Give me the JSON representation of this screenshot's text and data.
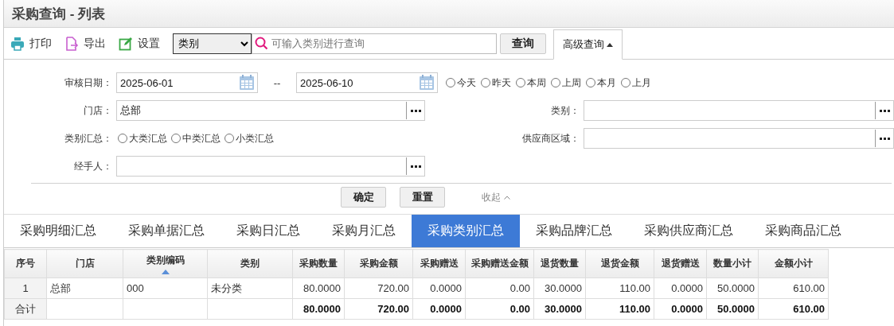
{
  "window": {
    "title": "采购查询 - 列表"
  },
  "toolbar": {
    "buttons": [
      {
        "kind": "print",
        "label": "打印"
      },
      {
        "kind": "export",
        "label": "导出"
      },
      {
        "kind": "settings",
        "label": "设置"
      }
    ],
    "field_select": {
      "value": "类别"
    },
    "search": {
      "placeholder": "可输入类别进行查询"
    },
    "query_button": "查询",
    "advanced_tab": {
      "label": "高级查询",
      "expanded": true
    }
  },
  "filters": {
    "audit_date": {
      "label": "审核日期：",
      "from": "2025-06-01",
      "separator": "--",
      "to": "2025-06-10",
      "presets": [
        {
          "label": "今天",
          "selected": false
        },
        {
          "label": "昨天",
          "selected": false
        },
        {
          "label": "本周",
          "selected": false
        },
        {
          "label": "上周",
          "selected": false
        },
        {
          "label": "本月",
          "selected": false
        },
        {
          "label": "上月",
          "selected": false
        }
      ]
    },
    "rows": [
      [
        {
          "kind": "lookup",
          "label": "门店：",
          "value": "总部"
        },
        {
          "kind": "lookup",
          "label": "类别："
        }
      ],
      [
        {
          "kind": "radios",
          "label": "类别汇总：",
          "options": [
            {
              "label": "大类汇总",
              "selected": false
            },
            {
              "label": "中类汇总",
              "selected": false
            },
            {
              "label": "小类汇总",
              "selected": false
            }
          ]
        },
        {
          "kind": "lookup",
          "label": "供应商区域："
        }
      ],
      [
        {
          "kind": "lookup",
          "label": "经手人："
        }
      ]
    ],
    "confirm_button": "确定",
    "reset_button": "重置",
    "collapse_link": "收起"
  },
  "tabs": [
    {
      "label": "采购明细汇总",
      "selected": false
    },
    {
      "label": "采购单据汇总",
      "selected": false
    },
    {
      "label": "采购日汇总",
      "selected": false
    },
    {
      "label": "采购月汇总",
      "selected": false
    },
    {
      "label": "采购类别汇总",
      "selected": true
    },
    {
      "label": "采购品牌汇总",
      "selected": false
    },
    {
      "label": "采购供应商汇总",
      "selected": false
    },
    {
      "label": "采购商品汇总",
      "selected": false
    }
  ],
  "table": {
    "columns": [
      {
        "label": "序号",
        "sorted": false
      },
      {
        "label": "门店",
        "sorted": false
      },
      {
        "label": "类别编码",
        "sorted": true
      },
      {
        "label": "类别",
        "sorted": false
      },
      {
        "label": "采购数量",
        "sorted": false
      },
      {
        "label": "采购金额",
        "sorted": false
      },
      {
        "label": "采购赠送",
        "sorted": false
      },
      {
        "label": "采购赠送金额",
        "sorted": false
      },
      {
        "label": "退货数量",
        "sorted": false
      },
      {
        "label": "退货金额",
        "sorted": false
      },
      {
        "label": "退货赠送",
        "sorted": false
      },
      {
        "label": "数量小计",
        "sorted": false
      },
      {
        "label": "金额小计",
        "sorted": false
      }
    ],
    "rows": [
      [
        "1",
        "总部",
        "000",
        "未分类",
        "80.0000",
        "720.00",
        "0.0000",
        "0.00",
        "30.0000",
        "110.00",
        "0.0000",
        "50.0000",
        "610.00"
      ]
    ],
    "total_row": {
      "label": "合计",
      "sums": [
        "80.0000",
        "720.00",
        "0.0000",
        "0.00",
        "30.0000",
        "110.00",
        "0.0000",
        "50.0000",
        "610.00"
      ]
    }
  }
}
